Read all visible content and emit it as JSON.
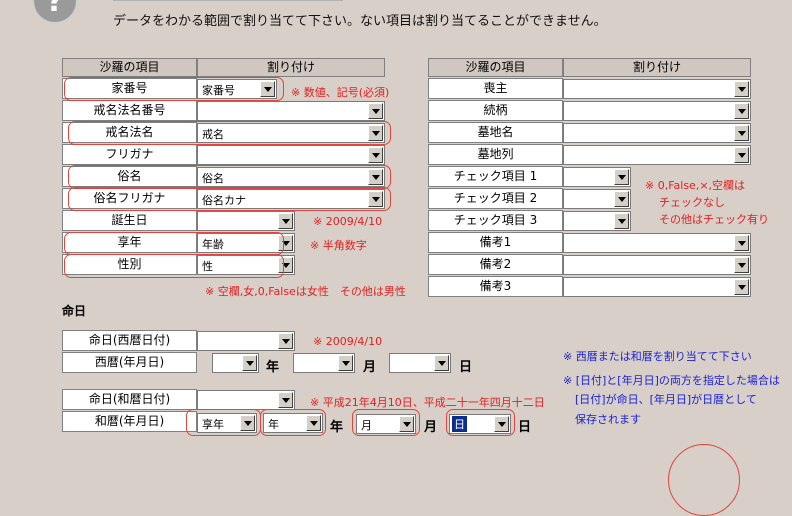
{
  "top_instruction": "データをわかる範囲で割り当てて下さい。ない項目は割り当てることができません。",
  "left_table": {
    "col_item": "沙羅の項目",
    "col_assign": "割り付け",
    "rows": [
      {
        "label": "家番号",
        "value": ""
      },
      {
        "label": "戒名法名番号",
        "value": ""
      },
      {
        "label": "戒名法名",
        "value": "戒名"
      },
      {
        "label": "フリガナ",
        "value": ""
      },
      {
        "label": "俗名",
        "value": "俗名"
      },
      {
        "label": "俗名フリガナ",
        "value": "俗名カナ"
      },
      {
        "label": "誕生日",
        "value": ""
      },
      {
        "label": "享年",
        "value": "年齢"
      },
      {
        "label": "性別",
        "value": "性"
      }
    ],
    "ie_bango_value": "家番号"
  },
  "right_table": {
    "col_item": "沙羅の項目",
    "col_assign": "割り付け",
    "rows": [
      {
        "label": "喪主"
      },
      {
        "label": "続柄"
      },
      {
        "label": "墓地名"
      },
      {
        "label": "墓地列"
      },
      {
        "label": "チェック項目 1"
      },
      {
        "label": "チェック項目 2"
      },
      {
        "label": "チェック項目 3"
      },
      {
        "label": "備考1"
      },
      {
        "label": "備考2"
      },
      {
        "label": "備考3"
      }
    ]
  },
  "notes": {
    "ie_bango": "※ 数値、記号(必須)",
    "birthday": "※ 2009/4/10",
    "kyonen": "※ 半角数字",
    "seibetsu": "※ 空欄,女,0,Falseは女性　その他は男性",
    "check_line1": "※ 0,False,×,空欄は",
    "check_line2": "チェックなし",
    "check_line3": "その他はチェック有り",
    "meinichi_seireki": "※ 2009/4/10",
    "meinichi_wareki": "※ 平成21年4月10日、平成二十一年四月十二日",
    "blue1": "※ 西暦または和暦を割り当てて下さい",
    "blue2": "※ [日付]と[年月日]の両方を指定した場合は",
    "blue3": "[日付]が命日、[年月日]が日暦として",
    "blue4": "保存されます"
  },
  "meinichi": {
    "section": "命日",
    "seireki_date_label": "命日(西暦日付)",
    "seireki_ymd_label": "西暦(年月日)",
    "wareki_date_label": "命日(和暦日付)",
    "wareki_ymd_label": "和暦(年月日)",
    "unit_year": "年",
    "unit_month": "月",
    "unit_day": "日",
    "wareki_era_value": "享年",
    "wareki_year_value": "年",
    "wareki_month_value": "月",
    "wareki_day_value": "日"
  }
}
